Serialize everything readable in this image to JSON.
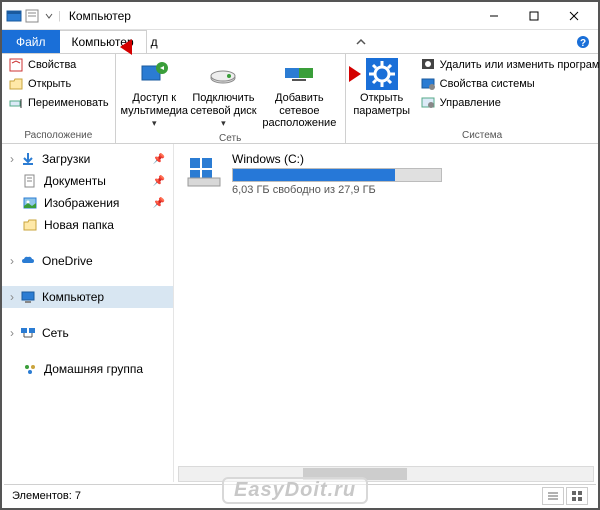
{
  "titlebar": {
    "title": "Компьютер"
  },
  "tabs": {
    "file": "Файл",
    "computer": "Компьютер",
    "hidden_suffix": "д"
  },
  "ribbon": {
    "group_location": {
      "label": "Расположение",
      "properties": "Свойства",
      "open": "Открыть",
      "rename": "Переименовать"
    },
    "group_network": {
      "label": "Сеть",
      "media_access": "Доступ к мультимедиа",
      "map_drive": "Подключить сетевой диск",
      "add_net_location": "Добавить сетевое расположение"
    },
    "group_system": {
      "label": "Система",
      "open_settings": "Открыть параметры",
      "uninstall": "Удалить или изменить программу",
      "sys_props": "Свойства системы",
      "manage": "Управление"
    }
  },
  "sidebar": {
    "downloads": "Загрузки",
    "documents": "Документы",
    "pictures": "Изображения",
    "new_folder": "Новая папка",
    "onedrive": "OneDrive",
    "computer": "Компьютер",
    "network": "Сеть",
    "homegroup": "Домашняя группа"
  },
  "drive": {
    "name": "Windows (C:)",
    "free_text": "6,03 ГБ свободно из 27,9 ГБ",
    "fill_percent": 78
  },
  "statusbar": {
    "count": "Элементов: 7"
  },
  "watermark": "EasyDoit.ru"
}
